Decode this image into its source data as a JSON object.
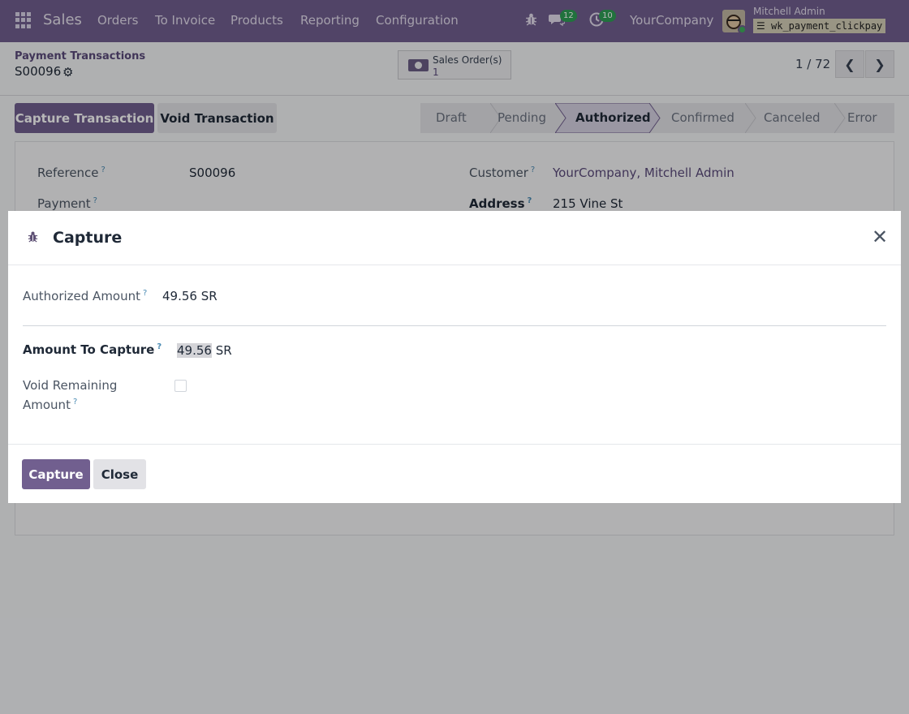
{
  "navbar": {
    "brand": "Sales",
    "menu": [
      "Orders",
      "To Invoice",
      "Products",
      "Reporting",
      "Configuration"
    ],
    "messages_count": "12",
    "activities_count": "10",
    "company": "YourCompany",
    "user": "Mitchell Admin",
    "database": "wk_payment_clickpay",
    "icons": [
      "apps-icon",
      "bug-icon",
      "chat-icon",
      "clock-icon",
      "database-icon"
    ]
  },
  "control": {
    "breadcrumb": "Payment Transactions",
    "record": "S00096",
    "smart_button": {
      "label": "Sales Order(s)",
      "count": "1"
    },
    "pager": "1 / 72"
  },
  "actions": {
    "capture": "Capture Transaction",
    "void": "Void Transaction"
  },
  "statusbar": {
    "stages": [
      "Draft",
      "Pending",
      "Authorized",
      "Confirmed",
      "Canceled",
      "Error"
    ],
    "active": "Authorized"
  },
  "form": {
    "reference_label": "Reference",
    "reference_value": "S00096",
    "payment_label": "Payment",
    "customer_label": "Customer",
    "customer_value": "YourCompany, Mitchell Admin",
    "address_label": "Address",
    "address_value": "215 Vine St"
  },
  "modal": {
    "title": "Capture",
    "authorized_label": "Authorized Amount",
    "authorized_value": "49.56 SR",
    "capture_label": "Amount To Capture",
    "capture_amount": "49.56",
    "capture_currency": " SR",
    "void_label_line1": "Void Remaining",
    "void_label_line2": "Amount",
    "void_checked": false,
    "capture_button": "Capture",
    "close_button": "Close"
  },
  "colors": {
    "brand": "#715f8f",
    "badge": "#2f9e55",
    "link": "#5a4a7a",
    "help": "#4a8bb3"
  }
}
